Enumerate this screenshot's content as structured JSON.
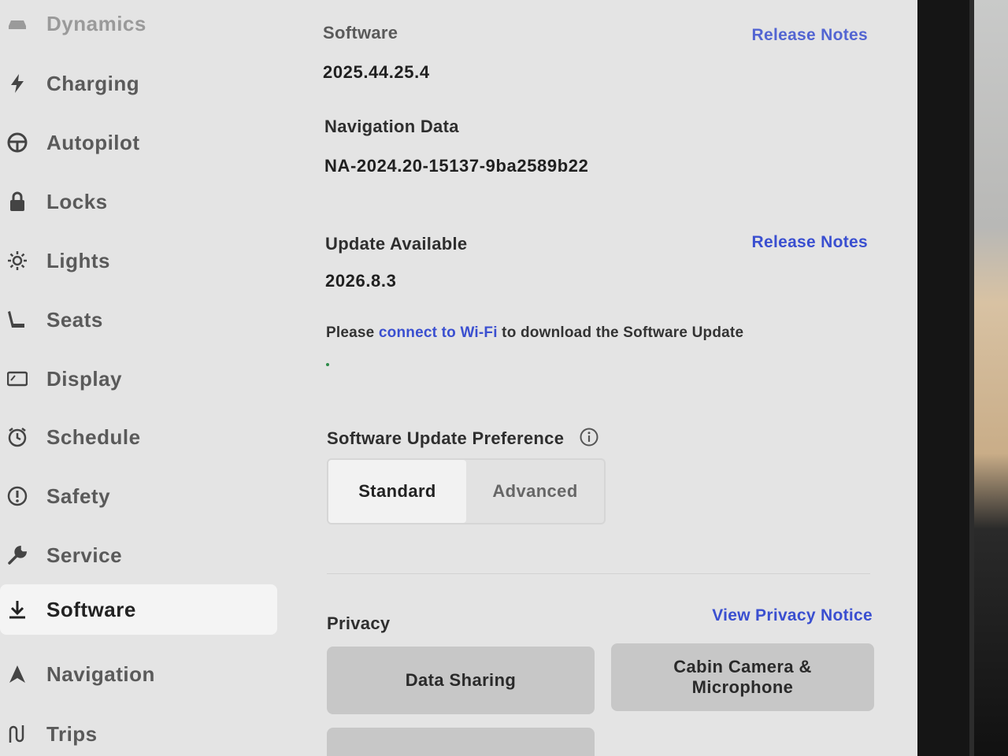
{
  "sidebar": {
    "items": [
      {
        "label": "Dynamics",
        "icon": "car-icon"
      },
      {
        "label": "Charging",
        "icon": "lightning-icon"
      },
      {
        "label": "Autopilot",
        "icon": "steering-wheel-icon"
      },
      {
        "label": "Locks",
        "icon": "lock-icon"
      },
      {
        "label": "Lights",
        "icon": "sun-icon"
      },
      {
        "label": "Seats",
        "icon": "seat-icon"
      },
      {
        "label": "Display",
        "icon": "display-icon"
      },
      {
        "label": "Schedule",
        "icon": "alarm-clock-icon"
      },
      {
        "label": "Safety",
        "icon": "alert-circle-icon"
      },
      {
        "label": "Service",
        "icon": "wrench-icon"
      },
      {
        "label": "Software",
        "icon": "download-icon",
        "active": true
      },
      {
        "label": "Navigation",
        "icon": "navigation-arrow-icon"
      },
      {
        "label": "Trips",
        "icon": "trips-icon"
      }
    ]
  },
  "software": {
    "label": "Software",
    "version": "2025.44.25.4",
    "release_notes_link": "Release Notes"
  },
  "navigation_data": {
    "label": "Navigation Data",
    "value": "NA-2024.20-15137-9ba2589b22"
  },
  "update": {
    "label": "Update Available",
    "version": "2026.8.3",
    "release_notes_link": "Release Notes",
    "message_before": "Please ",
    "message_link": "connect to Wi-Fi",
    "message_after": " to download the Software Update"
  },
  "preference": {
    "label": "Software Update Preference",
    "options": [
      "Standard",
      "Advanced"
    ],
    "selected": "Standard"
  },
  "privacy": {
    "label": "Privacy",
    "notice_link": "View Privacy Notice",
    "tiles": [
      "Data Sharing",
      "Cabin Camera & Microphone"
    ]
  },
  "colors": {
    "accent_link": "#3a4fd0",
    "screen_bg": "#e4e4e4",
    "active_item_bg": "#f4f4f4"
  }
}
